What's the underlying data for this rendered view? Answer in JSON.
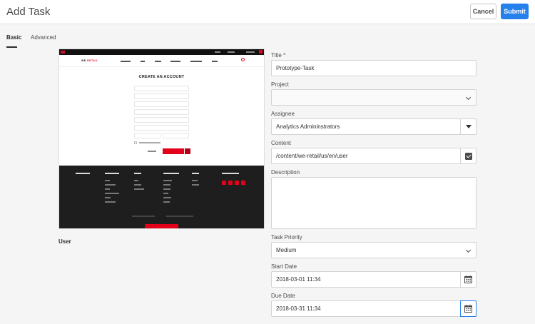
{
  "header": {
    "title": "Add Task",
    "cancel_label": "Cancel",
    "submit_label": "Submit"
  },
  "tabs": [
    {
      "label": "Basic",
      "active": true
    },
    {
      "label": "Advanced",
      "active": false
    }
  ],
  "preview": {
    "page_heading": "CREATE AN ACCOUNT",
    "caption": "User"
  },
  "form": {
    "title": {
      "label": "Title *",
      "value": "Prototype-Task"
    },
    "project": {
      "label": "Project",
      "value": ""
    },
    "assignee": {
      "label": "Assignee",
      "value": "Analytics Admininstrators"
    },
    "content": {
      "label": "Content",
      "value": "/content/we-retail/us/en/user"
    },
    "description": {
      "label": "Description",
      "value": ""
    },
    "task_priority": {
      "label": "Task Priority",
      "value": "Medium"
    },
    "start_date": {
      "label": "Start Date",
      "value": "2018-03-01 11:34"
    },
    "due_date": {
      "label": "Due Date",
      "value": "2018-03-31 11:34"
    }
  },
  "icons": {
    "chevron": "chevron-down-icon",
    "dropdown": "triangle-down-icon",
    "browse": "checkbox-check-icon",
    "calendar": "calendar-icon"
  },
  "colors": {
    "accent": "#2680eb",
    "brand_red": "#e2001a"
  }
}
